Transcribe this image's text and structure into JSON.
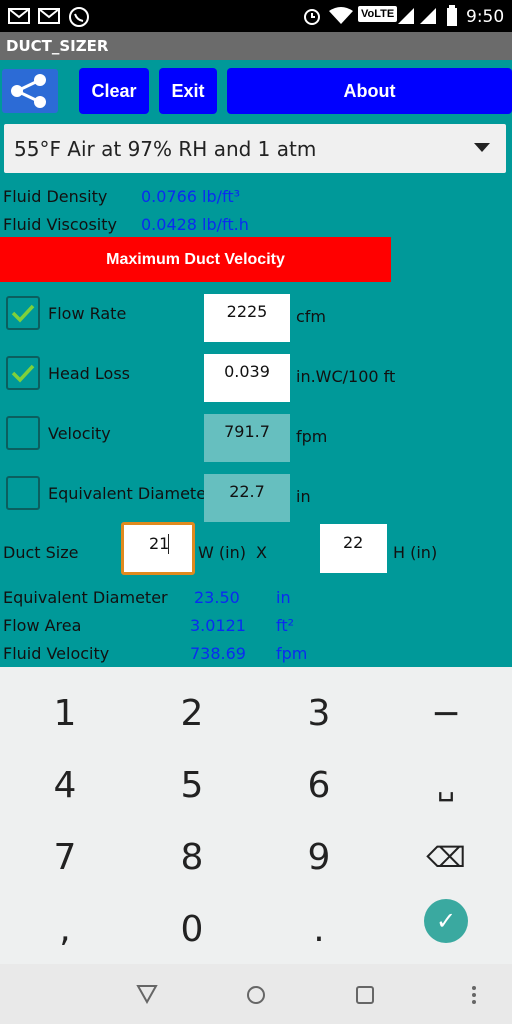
{
  "status_bar": {
    "time": "9:50",
    "volte": "VoLTE"
  },
  "app": {
    "title": "DUCT_SIZER"
  },
  "toolbar": {
    "clear": "Clear",
    "exit": "Exit",
    "about": "About"
  },
  "fluid": {
    "selected": "55°F Air at 97% RH and 1 atm"
  },
  "properties": {
    "density_label": "Fluid Density",
    "density_value": "0.0766",
    "density_unit": "lb/ft³",
    "viscosity_label": "Fluid Viscosity",
    "viscosity_value": "0.0428",
    "viscosity_unit": "lb/ft.h"
  },
  "max_velocity_button": "Maximum Duct Velocity",
  "inputs": [
    {
      "label": "Flow Rate",
      "checked": true,
      "value": "2225",
      "unit": "cfm"
    },
    {
      "label": "Head Loss",
      "checked": true,
      "value": "0.039",
      "unit": "in.WC/100 ft"
    },
    {
      "label": "Velocity",
      "checked": false,
      "value": "791.7",
      "unit": "fpm"
    },
    {
      "label": "Equivalent Diameter",
      "checked": false,
      "value": "22.7",
      "unit": "in"
    }
  ],
  "duct_size": {
    "label": "Duct Size",
    "width": "21",
    "width_unit": "W (in)",
    "x": "X",
    "height": "22",
    "height_unit": "H (in)"
  },
  "results": [
    {
      "label": "Equivalent Diameter",
      "value": "23.50",
      "unit": "in"
    },
    {
      "label": "Flow Area",
      "value": "3.0121",
      "unit": "ft²"
    },
    {
      "label": "Fluid Velocity",
      "value": "738.69",
      "unit": "fpm"
    }
  ],
  "keypad": {
    "keys": [
      "1",
      "2",
      "3",
      "−",
      "4",
      "5",
      "6",
      "␣",
      "7",
      "8",
      "9",
      "⌫",
      ",",
      "0",
      ".",
      "✓"
    ]
  },
  "colors": {
    "background": "#009999",
    "button_blue": "#0000ff",
    "warning_red": "#ff0000",
    "accent_teal": "#3aa9a0"
  }
}
